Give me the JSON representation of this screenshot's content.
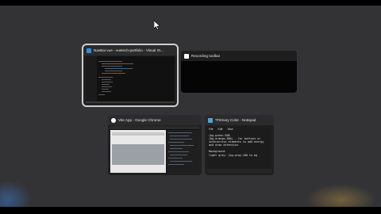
{
  "switcher": {
    "windows": [
      {
        "title": "NavBar.vue - vuetech-portfolio - Visual St...",
        "app": "vscode",
        "selected": true
      },
      {
        "title": "Recording toolbar",
        "app": "recording",
        "selected": false
      },
      {
        "title": "Vite App - Google Chrome",
        "app": "chrome",
        "selected": false
      },
      {
        "title": "*Primary Color - Notepad",
        "app": "notepad",
        "selected": false
      }
    ],
    "notepad": {
      "menu": [
        "File",
        "Edit",
        "View"
      ],
      "lines": [
        "(bg-green-500",
        "(bg-orange-500) - for buttons or",
        "interactive elements to add energy",
        "and draw attention.",
        "",
        "Background",
        "light gray: (bg-gray-100 to bg"
      ]
    }
  },
  "colors": {
    "vscode_icon": "#2f8fe0",
    "chrome_icon": "#ffffff",
    "notepad_icon": "#4aa3df",
    "recording_icon": "#ffffff"
  }
}
